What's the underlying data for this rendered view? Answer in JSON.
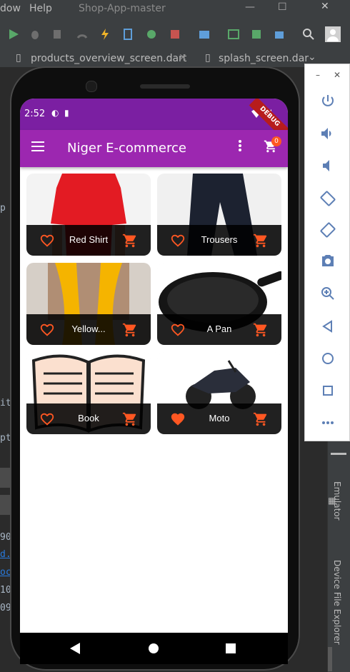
{
  "ide": {
    "menu": [
      "dow",
      "Help"
    ],
    "project_title": "Shop-App-master",
    "tabs": [
      "products_overview_screen.dart",
      "splash_screen.dar"
    ],
    "side_tabs": [
      "Emulator",
      "Device File Explorer"
    ],
    "code_fragments": [
      "p",
      "it",
      "pt",
      "90",
      "d.",
      "oc",
      "10",
      "09"
    ]
  },
  "phone": {
    "status": {
      "time": "2:52",
      "debug_banner": "DEBUG"
    },
    "appbar": {
      "title": "Niger E-commerce",
      "cart_count": "0"
    },
    "products": [
      {
        "title": "Red Shirt",
        "favorite": false
      },
      {
        "title": "Trousers",
        "favorite": false
      },
      {
        "title": "Yellow...",
        "favorite": false
      },
      {
        "title": "A Pan",
        "favorite": false
      },
      {
        "title": "Book",
        "favorite": false
      },
      {
        "title": "Moto",
        "favorite": true
      }
    ]
  },
  "colors": {
    "primary": "#9c27b0",
    "primary_dark": "#7b1fa2",
    "accent": "#ff5722",
    "badge": "#ff5722"
  },
  "icons": [
    "menu-icon",
    "more-vert-icon",
    "cart-icon",
    "favorite-border-icon",
    "favorite-icon",
    "add-shopping-cart-icon",
    "power-icon",
    "volume-up-icon",
    "volume-down-icon",
    "rotate-left-icon",
    "rotate-right-icon",
    "camera-icon",
    "zoom-in-icon",
    "back-icon",
    "home-icon",
    "overview-icon",
    "more-horiz-icon"
  ]
}
